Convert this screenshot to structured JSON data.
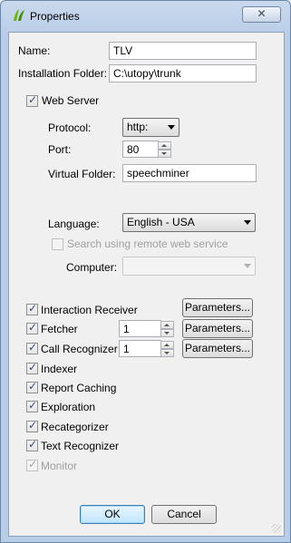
{
  "window": {
    "title": "Properties",
    "close_glyph": "✕"
  },
  "general": {
    "name_label": "Name:",
    "name_value": "TLV",
    "folder_label": "Installation Folder:",
    "folder_value": "C:\\utopy\\trunk"
  },
  "web_server": {
    "label": "Web Server",
    "checked": true,
    "protocol_label": "Protocol:",
    "protocol_value": "http:",
    "port_label": "Port:",
    "port_value": "80",
    "vfolder_label": "Virtual Folder:",
    "vfolder_value": "speechminer"
  },
  "language": {
    "label": "Language:",
    "value": "English - USA",
    "remote_label": "Search using remote web service",
    "remote_checked": false,
    "computer_label": "Computer:",
    "computer_value": ""
  },
  "components": {
    "interaction_receiver": {
      "label": "Interaction Receiver",
      "checked": true,
      "params": "Parameters..."
    },
    "fetcher": {
      "label": "Fetcher",
      "checked": true,
      "value": "1",
      "params": "Parameters..."
    },
    "call_recognizer": {
      "label": "Call Recognizer",
      "checked": true,
      "value": "1",
      "params": "Parameters..."
    },
    "indexer": {
      "label": "Indexer",
      "checked": true
    },
    "report_caching": {
      "label": "Report Caching",
      "checked": true
    },
    "exploration": {
      "label": "Exploration",
      "checked": true
    },
    "recategorizer": {
      "label": "Recategorizer",
      "checked": true
    },
    "text_recognizer": {
      "label": "Text Recognizer",
      "checked": true
    },
    "monitor": {
      "label": "Monitor",
      "checked": true,
      "disabled": true
    }
  },
  "footer": {
    "ok_label": "OK",
    "cancel_label": "Cancel"
  },
  "colors": {
    "title_bar": "#c9d9ee",
    "dialog_bg": "#f0f0f0",
    "check_mark": "#2b4a84"
  }
}
